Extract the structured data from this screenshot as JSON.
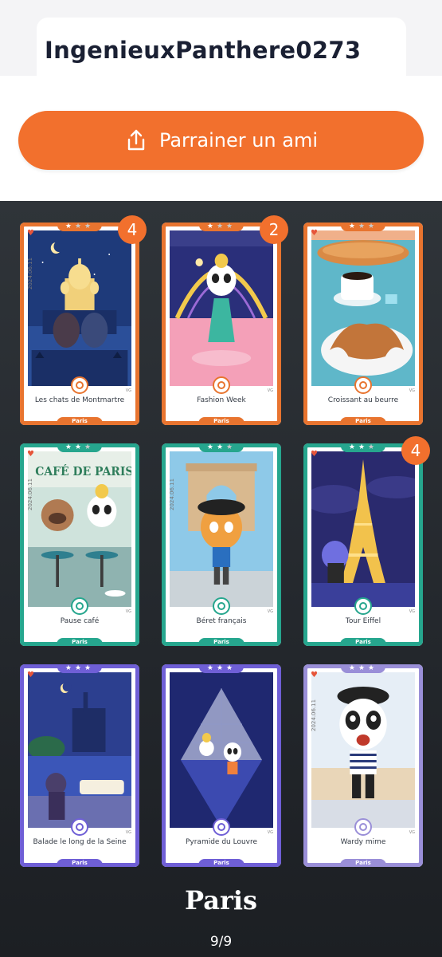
{
  "header": {
    "username": "IngenieuxPanthere0273"
  },
  "refer": {
    "label": "Parrainer un ami",
    "icon": "share-icon",
    "color": "#f2702d"
  },
  "collection": {
    "title": "Paris",
    "page": "9/9",
    "cards": [
      {
        "title": "Les chats de Montmartre",
        "city": "Paris",
        "count": "4",
        "rarity": 1,
        "frame": "#e8742f",
        "date": "2024.06.11",
        "icon": "bell-icon"
      },
      {
        "title": "Fashion Week",
        "city": "Paris",
        "count": "2",
        "rarity": 1,
        "frame": "#e8742f",
        "date": "",
        "icon": "music-note-icon"
      },
      {
        "title": "Croissant au beurre",
        "city": "Paris",
        "count": "",
        "rarity": 1,
        "frame": "#e8742f",
        "date": "",
        "icon": "cutlery-icon"
      },
      {
        "title": "Pause café",
        "city": "Paris",
        "count": "",
        "rarity": 2,
        "frame": "#26a68e",
        "date": "2024.06.11",
        "icon": "coffee-icon"
      },
      {
        "title": "Béret français",
        "city": "Paris",
        "count": "",
        "rarity": 2,
        "frame": "#26a68e",
        "date": "2024.06.11",
        "icon": "beret-icon"
      },
      {
        "title": "Tour Eiffel",
        "city": "Paris",
        "count": "4",
        "rarity": 2,
        "frame": "#26a68e",
        "date": "",
        "icon": "location-pin-icon"
      },
      {
        "title": "Balade le long de la Seine",
        "city": "Paris",
        "count": "",
        "rarity": 3,
        "frame": "#6f5fd6",
        "date": "",
        "icon": "map-icon"
      },
      {
        "title": "Pyramide du Louvre",
        "city": "Paris",
        "count": "",
        "rarity": 3,
        "frame": "#6f5fd6",
        "date": "",
        "icon": "location-pin-icon"
      },
      {
        "title": "Wardy mime",
        "city": "Paris",
        "count": "",
        "rarity": 3,
        "frame": "#9a8fd8",
        "date": "2024.06.11",
        "icon": "smile-icon"
      }
    ]
  }
}
